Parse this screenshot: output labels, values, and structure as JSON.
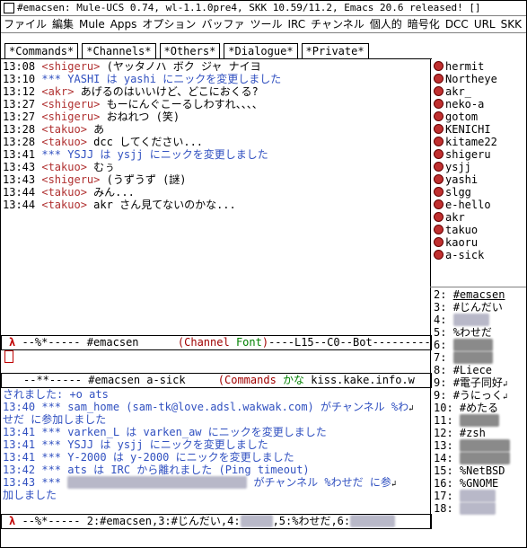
{
  "window": {
    "title": "#emacsen: Mule-UCS 0.74, wl-1.1.0pre4, SKK 10.59/11.2, Emacs 20.6 released! []"
  },
  "menu": [
    "ファイル",
    "編集",
    "Mule",
    "Apps",
    "オプション",
    "バッファ",
    "ツール",
    "IRC",
    "チャンネル",
    "個人的",
    "暗号化",
    "DCC",
    "URL",
    "SKK"
  ],
  "tabs": [
    "*Commands*",
    "*Channels*",
    "*Others*",
    "*Dialogue*",
    "*Private*"
  ],
  "upper_messages": [
    {
      "time": "13:08",
      "nick": "<shigeru>",
      "text": "(ヤッタノハ ボク ジャ ナイヨ",
      "kind": "msg"
    },
    {
      "time": "13:10",
      "nick": "***",
      "text": "YASHI は yashi にニックを変更しました",
      "kind": "sys"
    },
    {
      "time": "13:12",
      "nick": "<akr>",
      "text": "あげるのはいいけど、どこにおくる?",
      "kind": "msg"
    },
    {
      "time": "13:27",
      "nick": "<shigeru>",
      "text": "もーにんぐこーるしわすれ、、、、",
      "kind": "msg"
    },
    {
      "time": "13:27",
      "nick": "<shigeru>",
      "text": "おねれつ (笑)",
      "kind": "msg"
    },
    {
      "time": "13:28",
      "nick": "<takuo>",
      "text": "あ",
      "kind": "msg"
    },
    {
      "time": "13:28",
      "nick": "<takuo>",
      "text": "dcc してください...",
      "kind": "msg"
    },
    {
      "time": "13:41",
      "nick": "***",
      "text": "YSJJ は ysjj にニックを変更しました",
      "kind": "sys"
    },
    {
      "time": "13:43",
      "nick": "<takuo>",
      "text": "むぅ",
      "kind": "msg"
    },
    {
      "time": "13:43",
      "nick": "<shigeru>",
      "text": "(うずうず (謎)",
      "kind": "msg"
    },
    {
      "time": "13:44",
      "nick": "<takuo>",
      "text": "みん...",
      "kind": "msg"
    },
    {
      "time": "13:44",
      "nick": "<takuo>",
      "text": "akr さん見てないのかな...",
      "kind": "msg"
    }
  ],
  "upper_modeline": {
    "prefix": "--%*-----",
    "buffer": "#emacsen",
    "mode_open": "(",
    "mode": "Channel",
    "minor": "Font",
    "mode_close": ")",
    "rest": "----L15--C0--Bot---------"
  },
  "lower_modeline": {
    "prefix": "--**-----",
    "buffer": "#emacsen a-sick",
    "mode_open": "(",
    "mode": "Commands",
    "minor": "かな",
    "rest": "kiss.kake.info.w"
  },
  "lower_messages": [
    {
      "lines": [
        "されました: +o ats"
      ],
      "kind": "sys"
    },
    {
      "lines": [
        "13:40 *** sam_home (sam-tk@love.adsl.wakwak.com) がチャンネル %わ",
        "せだ に参加しました"
      ],
      "kind": "sys"
    },
    {
      "lines": [
        "13:41 *** varken_L は varken_aw にニックを変更しました"
      ],
      "kind": "sys"
    },
    {
      "lines": [
        "13:41 *** YSJJ は ysjj にニックを変更しました"
      ],
      "kind": "sys"
    },
    {
      "lines": [
        "13:41 *** Y-2000 は y-2000 にニックを変更しました"
      ],
      "kind": "sys"
    },
    {
      "lines": [
        "13:42 *** ats は IRC から離れました (Ping timeout)"
      ],
      "kind": "sys"
    },
    {
      "lines": [
        "13:43 ***",
        "加しました"
      ],
      "kind": "sys-blur",
      "tail": "がチャンネル %わせだ に参"
    }
  ],
  "bottom_modeline": {
    "prefix": "--%*-----",
    "text": "2:#emacsen,3:#じんだい,4:",
    "text2": ",5:%わせだ,6:"
  },
  "nicks": [
    "hermit",
    "Northeye",
    "akr_",
    "neko-a",
    "gotom",
    "KENICHI",
    "kitame22",
    "shigeru",
    "ysjj",
    "yashi",
    "slgg",
    "e-hello",
    "akr",
    "takuo",
    "kaoru",
    "a-sick"
  ],
  "channels": [
    {
      "num": "2:",
      "name": "#emacsen",
      "current": true
    },
    {
      "num": "3:",
      "name": "#じんだい"
    },
    {
      "num": "4:",
      "name": "",
      "blur": true
    },
    {
      "num": "5:",
      "name": "%わせだ"
    },
    {
      "num": "6:",
      "name": "",
      "blur": true
    },
    {
      "num": "7:",
      "name": "",
      "blur": true
    },
    {
      "num": "8:",
      "name": "#Liece"
    },
    {
      "num": "9:",
      "name": "#電子同好"
    },
    {
      "num": "9:",
      "name": "#うにっく"
    },
    {
      "num": "10:",
      "name": "#めたる"
    },
    {
      "num": "11:",
      "name": "",
      "blur": true
    },
    {
      "num": "12:",
      "name": "#zsh"
    },
    {
      "num": "13:",
      "name": "",
      "blur": true
    },
    {
      "num": "14:",
      "name": "",
      "blur": true
    },
    {
      "num": "15:",
      "name": "%NetBSD"
    },
    {
      "num": "16:",
      "name": "%GNOME"
    },
    {
      "num": "17:",
      "name": "",
      "blur": true
    },
    {
      "num": "18:",
      "name": "",
      "blur": true
    }
  ]
}
